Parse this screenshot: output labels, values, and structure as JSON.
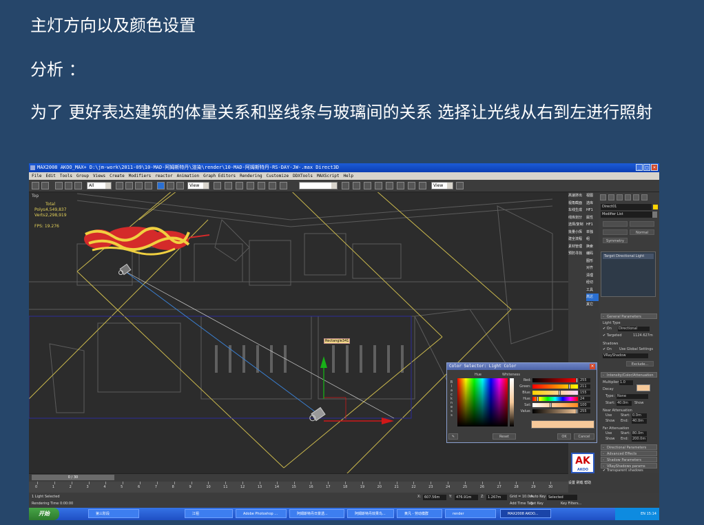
{
  "slide": {
    "heading": "主灯方向以及颜色设置",
    "analysis": "分析 ：",
    "description": "为了 更好表达建筑的体量关系和竖线条与玻璃间的关系 选择让光线从右到左进行照射"
  },
  "app": {
    "title": "MAX2008     AKOO_MAX+     D:\\jm-work\\2011-09\\10-MAD-阿姆斯特丹\\渲染\\render\\10-MAD-阿姆斯特丹-RS-DAY-JW-.max     Direct3D",
    "menu": [
      "File",
      "Edit",
      "Tools",
      "Group",
      "Views",
      "Create",
      "Modifiers",
      "reactor",
      "Animation",
      "Graph Editors",
      "Rendering",
      "Customize",
      "DDXTools",
      "MAXScript",
      "Help"
    ],
    "toolbar": {
      "selection_filter": "All",
      "ref_coord": "View",
      "view2": "View"
    }
  },
  "viewport": {
    "label": "Top",
    "stats": [
      {
        "key": "",
        "value": "Total"
      },
      {
        "key": "Polys:",
        "value": "4,549,837"
      },
      {
        "key": "Verts:",
        "value": "2,298,919"
      }
    ],
    "fps_label": "FPS:",
    "fps_value": "19.276",
    "object_tag": "Rectangle341"
  },
  "cn_tools": {
    "left": [
      "高速挤出",
      "视角截面",
      "车线生成",
      "线库划分",
      "选择/复制",
      "批量小挥",
      "建全流程",
      "素材管理",
      "预防寻找"
    ],
    "right": [
      "视图",
      "选库",
      "HF1",
      "属性",
      "HF1",
      "单独",
      "组",
      "换索",
      "编码",
      "图形",
      "对齐",
      "清理",
      "经切",
      "工具",
      "高达",
      "其它"
    ]
  },
  "command_panel": {
    "object_name": "Direct01",
    "modifier_list": "Modifier List",
    "normal_btn": "Normal",
    "symmetry_btn": "Symmetry",
    "stack_item": "Target Directional Light",
    "general_params": "General Parameters",
    "light_type": "Light Type",
    "on": "On",
    "light_type_value": "Directional",
    "targeted": "Targeted",
    "target_dist": "1124.627m",
    "shadows": "Shadows",
    "use_global": "Use Global Settings",
    "shadow_type": "VRayShadow",
    "exclude": "Exclude...",
    "intensity": "Intensity/Color/Attenuation",
    "multiplier_label": "Multiplier:",
    "multiplier": "1.0",
    "decay": "Decay",
    "decay_type_label": "Type:",
    "decay_type": "None",
    "start_label": "Start:",
    "decay_start": "40.0m",
    "show": "Show",
    "near_atten": "Near Attenuation",
    "use": "Use",
    "near_start": "0.0m",
    "end_label": "End:",
    "near_end": "40.0m",
    "far_atten": "Far Attenuation",
    "far_start": "80.0m",
    "far_end": "200.0m",
    "directional_params": "Directional Parameters",
    "advanced_effects": "Advanced Effects",
    "shadow_params": "Shadow Parameters",
    "vray_shadow_params": "VRayShadows params",
    "transparent_shadows": "Transparent shadows"
  },
  "logo": {
    "letters": "AK",
    "sub": "设置 刷载 帮助"
  },
  "color_dialog": {
    "title": "Color Selector: Light Color",
    "hue_label": "Hue",
    "whiteness_label": "Whiteness",
    "blackness_label": "Blackness",
    "channels": [
      {
        "label": "Red:",
        "value": "255",
        "fraction": 1.0,
        "colors": [
          "#000000",
          "#ff0000"
        ]
      },
      {
        "label": "Green:",
        "value": "211",
        "fraction": 0.83,
        "colors": [
          "#ff0000",
          "#ffff00"
        ]
      },
      {
        "label": "Blue:",
        "value": "155",
        "fraction": 0.61,
        "colors": [
          "#ffd300",
          "#ffd3ff"
        ]
      },
      {
        "label": "Hue:",
        "value": "24",
        "fraction": 0.09,
        "colors": [
          "#ff0000",
          "#ffff00",
          "#00ff00",
          "#00ffff",
          "#0000ff",
          "#ff00ff",
          "#ff0000"
        ]
      },
      {
        "label": "Sat:",
        "value": "100",
        "fraction": 0.39,
        "colors": [
          "#ffffff",
          "#ff8a1e"
        ]
      },
      {
        "label": "Value:",
        "value": "255",
        "fraction": 1.0,
        "colors": [
          "#000000",
          "#f6c99a"
        ]
      }
    ],
    "result_color": "#f6c99a",
    "reset": "Reset",
    "ok": "OK",
    "cancel": "Cancel"
  },
  "timeline": {
    "slider": "0 / 30",
    "ticks": [
      "0",
      "1",
      "2",
      "3",
      "4",
      "5",
      "6",
      "7",
      "8",
      "9",
      "10",
      "11",
      "12",
      "13",
      "14",
      "15",
      "16",
      "17",
      "18",
      "19",
      "20",
      "21",
      "22",
      "23",
      "24",
      "25",
      "26",
      "27",
      "28",
      "29",
      "30"
    ]
  },
  "status": {
    "selection": "1 Light Selected",
    "render_time": "Rendering Time 0:00:00",
    "x_label": "X:",
    "x": "607.56m",
    "y_label": "Y:",
    "y": "476.91m",
    "z_label": "Z:",
    "z": "1.267m",
    "grid": "Grid = 10.0m",
    "add_time_tag": "Add Time Tag",
    "auto_key": "Auto Key",
    "selected": "Selected",
    "set_key": "Set Key",
    "key_filters": "Key Filters..."
  },
  "taskbar": {
    "start": "开始",
    "items": [
      "第三阶段",
      "江祖",
      "Adobe Photoshop ...",
      "阿姆斯特丹日景透...",
      "阿姆斯特丹效果鸟...",
      "黄凡 - 劳动模群",
      "render",
      "MAX2008    AKOO..."
    ],
    "clock": "EN  15:14"
  }
}
